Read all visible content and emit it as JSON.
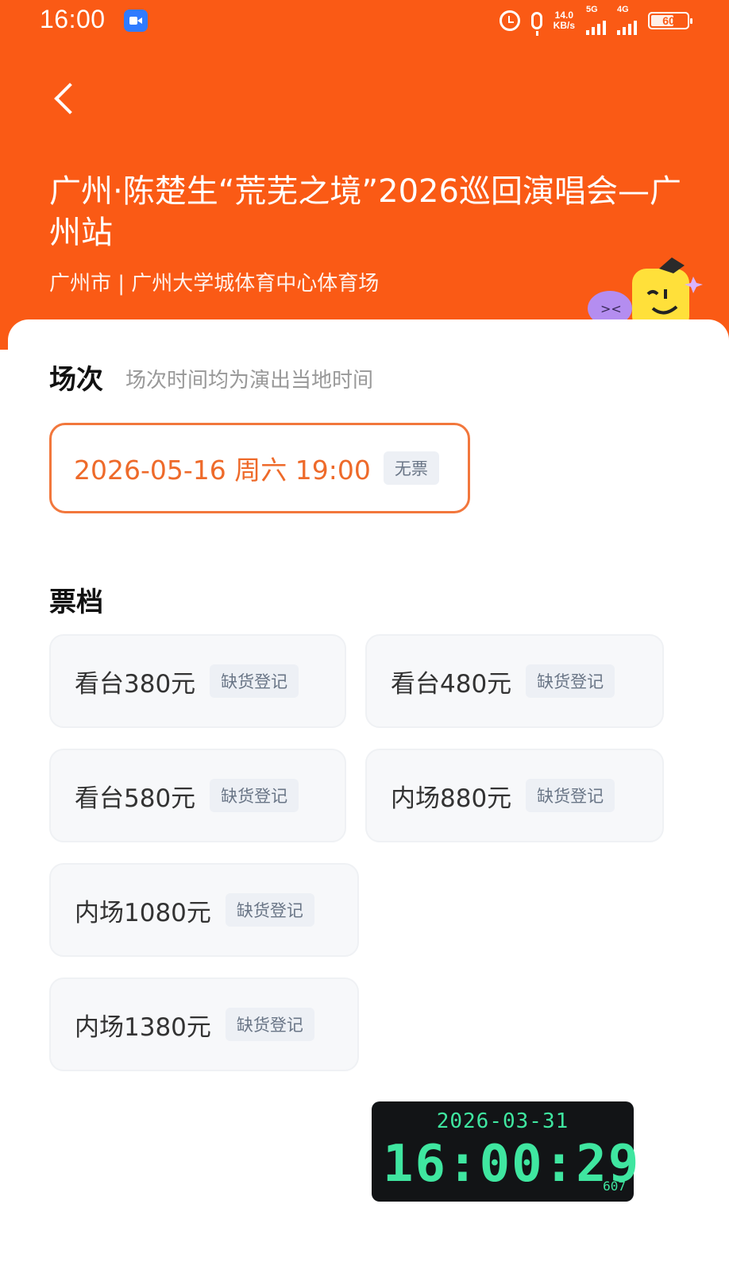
{
  "status_bar": {
    "time": "16:00",
    "net_speed_value": "14.0",
    "net_speed_unit": "KB/s",
    "signal_1_label": "5G",
    "signal_2_label": "4G",
    "battery": "60"
  },
  "header": {
    "title": "广州·陈楚生“荒芜之境”2026巡回演唱会—广州站",
    "venue": "广州市 | 广州大学城体育中心体育场",
    "background_color": "#fa5a15"
  },
  "sessions": {
    "title": "场次",
    "hint": "场次时间均为演出当地时间",
    "items": [
      {
        "date_time": "2026-05-16  周六 19:00",
        "status": "无票"
      }
    ]
  },
  "tiers": {
    "title": "票档",
    "items": [
      {
        "name": "看台380元",
        "status": "缺货登记"
      },
      {
        "name": "看台480元",
        "status": "缺货登记"
      },
      {
        "name": "看台580元",
        "status": "缺货登记"
      },
      {
        "name": "内场880元",
        "status": "缺货登记"
      },
      {
        "name": "内场1080元",
        "status": "缺货登记"
      },
      {
        "name": "内场1380元",
        "status": "缺货登记"
      }
    ]
  },
  "clock": {
    "date": "2026-03-31",
    "time": "16:00:29",
    "extra": "607"
  },
  "colors": {
    "accent": "#f2773c",
    "clock_digits": "#3fe6a0"
  }
}
